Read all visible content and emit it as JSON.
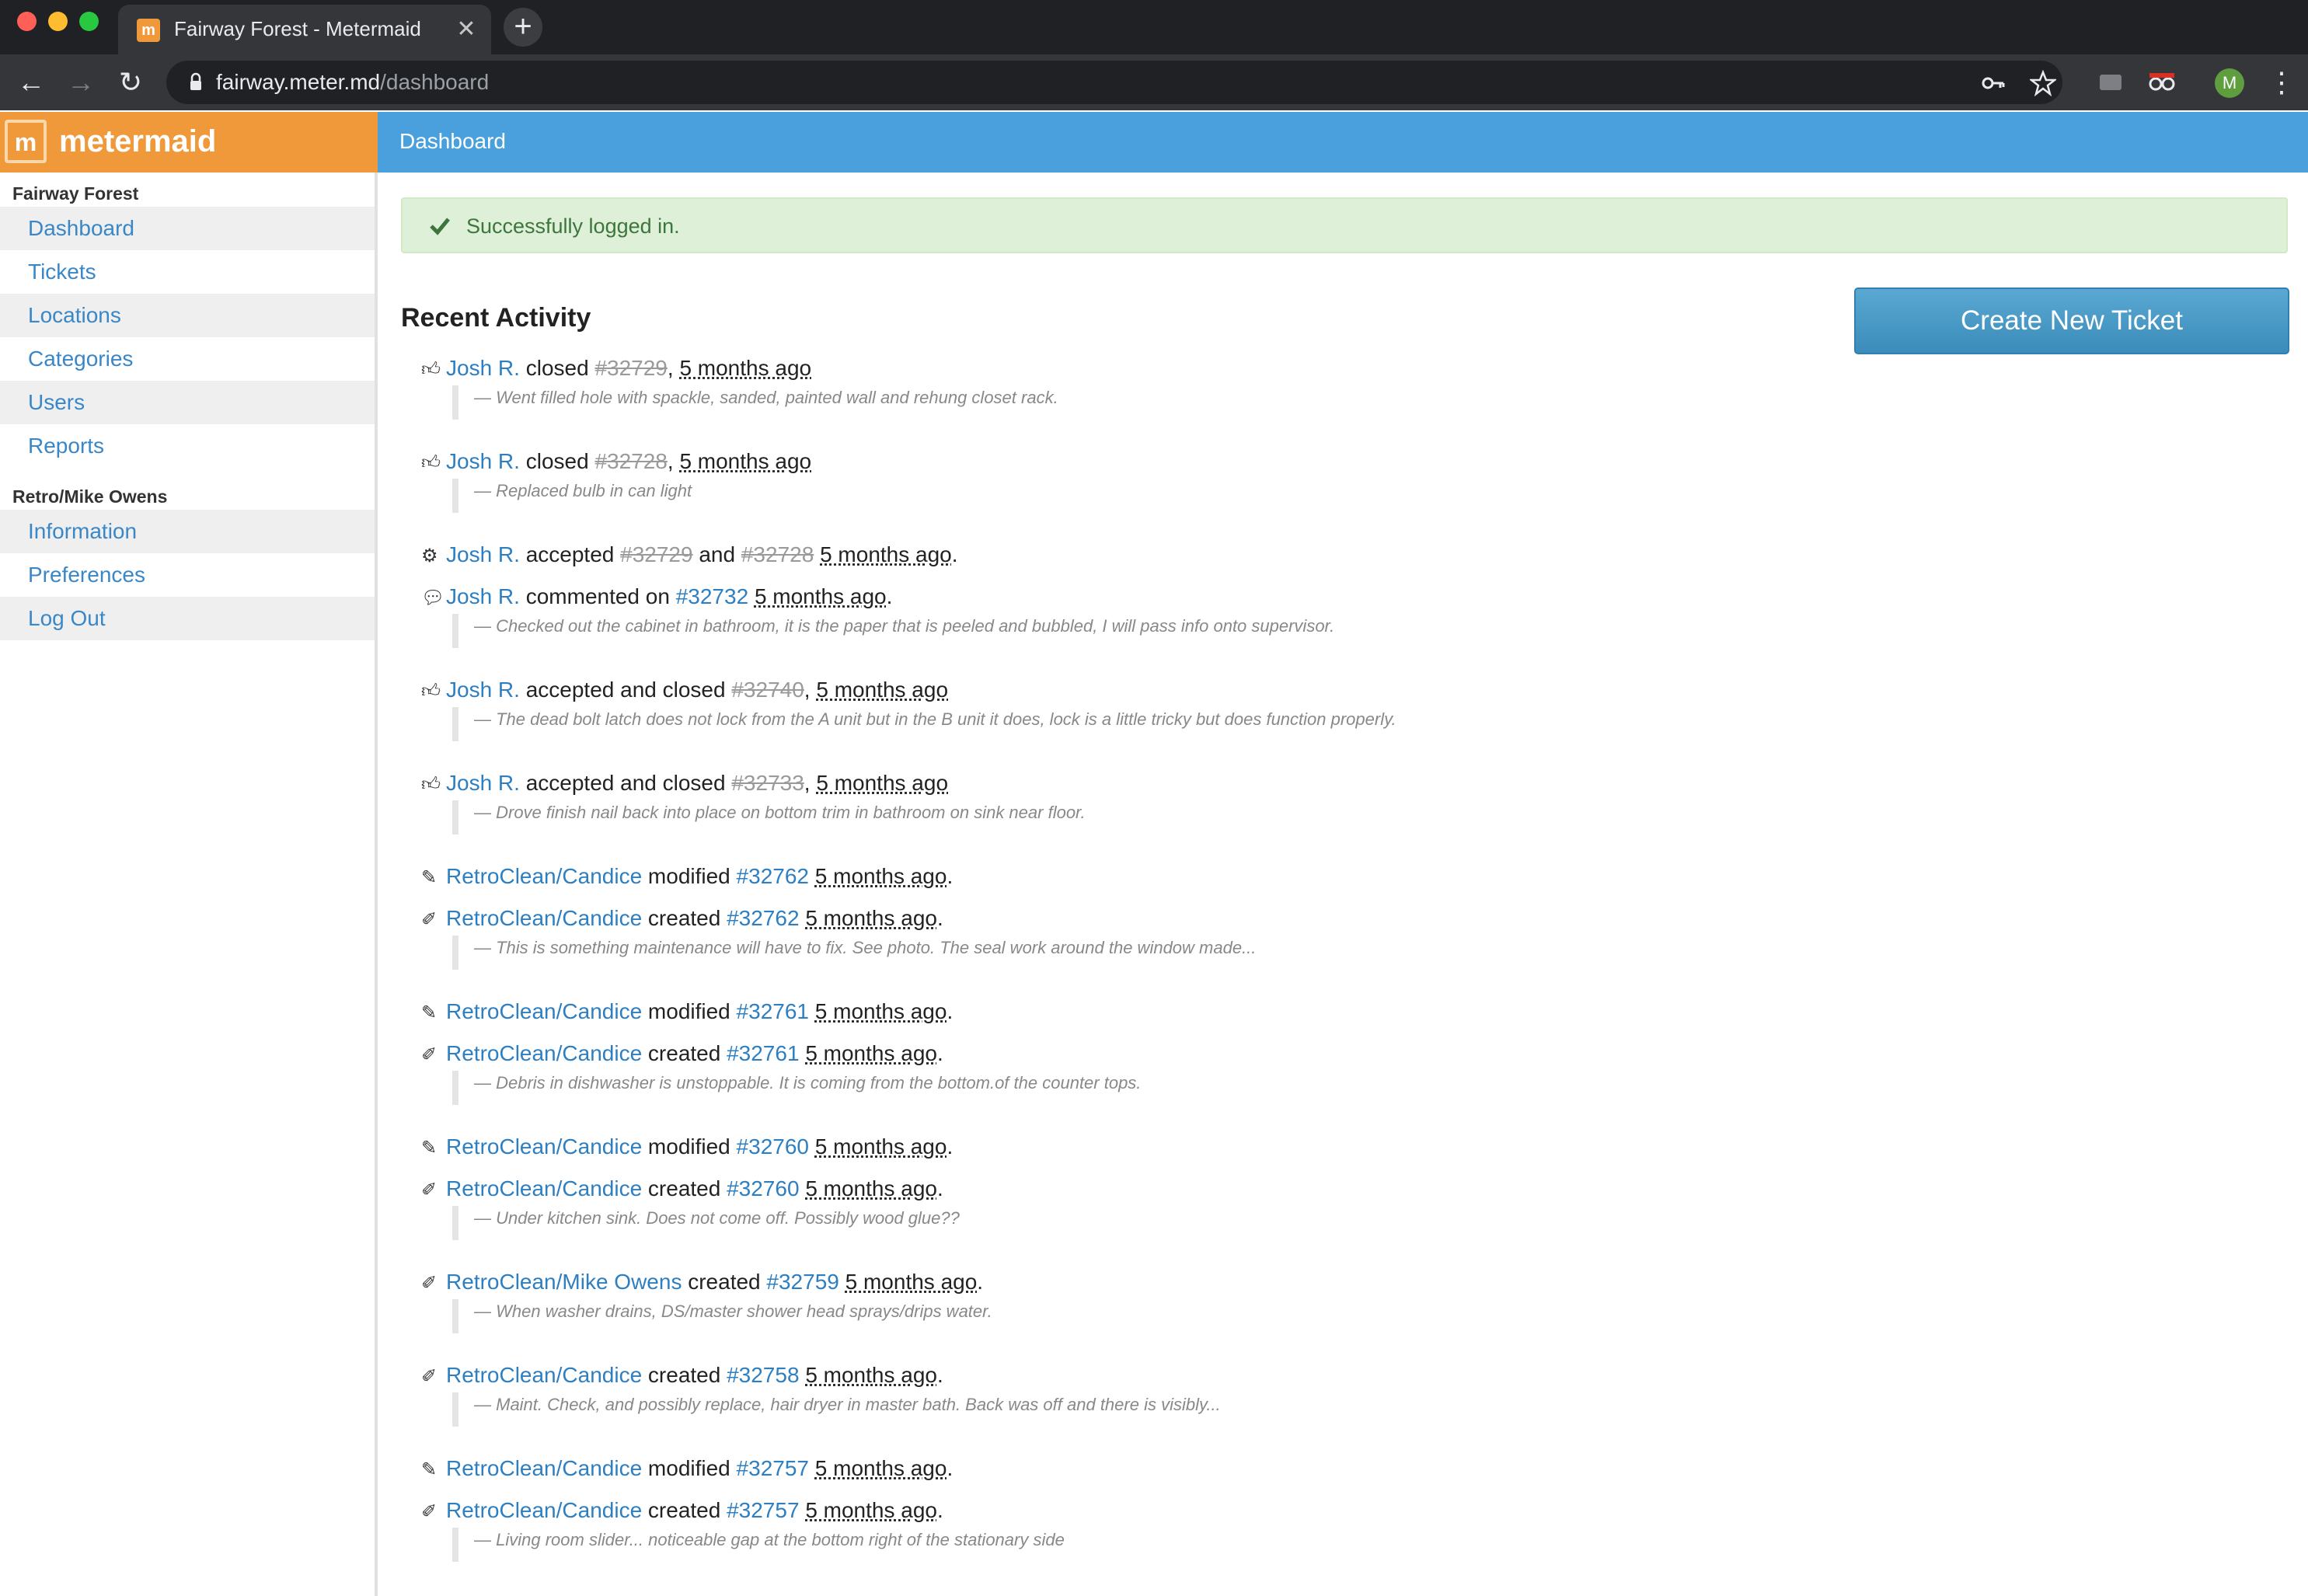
{
  "browser": {
    "tab_title": "Fairway Forest - Metermaid",
    "tab_favicon": "m",
    "tab_close": "✕",
    "new_tab": "+",
    "back": "←",
    "forward": "→",
    "reload": "↻",
    "url_host": "fairway.meter.md",
    "url_path": "/dashboard",
    "avatar_letter": "M",
    "menu": "⋮"
  },
  "app": {
    "logo_text": "metermaid",
    "logo_mark": "m",
    "page_title": "Dashboard"
  },
  "sidebar": {
    "section1": "Fairway Forest",
    "section1_items": [
      "Dashboard",
      "Tickets",
      "Locations",
      "Categories",
      "Users",
      "Reports"
    ],
    "section2": "Retro/Mike Owens",
    "section2_items": [
      "Information",
      "Preferences",
      "Log Out"
    ]
  },
  "alert": {
    "text": "Successfully logged in."
  },
  "recent_activity": {
    "title": "Recent Activity",
    "create_button": "Create New Ticket",
    "items": [
      {
        "icon": "thumbs-up-icon",
        "user": "Josh R.",
        "action": "closed",
        "tickets": [
          "#32729"
        ],
        "ago": "5 months ago",
        "comment": "— Went filled hole with spackle, sanded, painted wall and rehung closet rack."
      },
      {
        "icon": "thumbs-up-icon",
        "user": "Josh R.",
        "action": "closed",
        "tickets": [
          "#32728"
        ],
        "ago": "5 months ago",
        "comment": "— Replaced bulb in can light"
      },
      {
        "icon": "gears-icon",
        "user": "Josh R.",
        "action": "accepted",
        "tickets": [
          "#32729",
          "#32728"
        ],
        "ago": "5 months ago",
        "comment": ""
      },
      {
        "icon": "comment-icon",
        "user": "Josh R.",
        "action": "commented on",
        "tickets": [
          "#32732"
        ],
        "ago": "5 months ago",
        "comment": "— Checked out the cabinet in bathroom, it is the paper that is peeled and bubbled, I will pass info onto supervisor."
      },
      {
        "icon": "thumbs-up-icon",
        "user": "Josh R.",
        "action": "accepted and closed",
        "tickets": [
          "#32740"
        ],
        "ago": "5 months ago",
        "comment": "— The dead bolt latch does not lock from the A unit but in the B unit it does, lock is a little tricky but does function properly."
      },
      {
        "icon": "thumbs-up-icon",
        "user": "Josh R.",
        "action": "accepted and closed",
        "tickets": [
          "#32733"
        ],
        "ago": "5 months ago",
        "comment": "— Drove finish nail back into place on bottom trim in bathroom on sink near floor."
      },
      {
        "icon": "edit-icon",
        "user": "RetroClean/Candice",
        "action": "modified",
        "tickets": [
          "#32762"
        ],
        "ago": "5 months ago",
        "comment": ""
      },
      {
        "icon": "ticket-icon",
        "user": "RetroClean/Candice",
        "action": "created",
        "tickets": [
          "#32762"
        ],
        "ago": "5 months ago",
        "comment": "— This is something maintenance will have to fix. See photo. The seal work around the window made..."
      },
      {
        "icon": "edit-icon",
        "user": "RetroClean/Candice",
        "action": "modified",
        "tickets": [
          "#32761"
        ],
        "ago": "5 months ago",
        "comment": ""
      },
      {
        "icon": "ticket-icon",
        "user": "RetroClean/Candice",
        "action": "created",
        "tickets": [
          "#32761"
        ],
        "ago": "5 months ago",
        "comment": "— Debris in dishwasher is unstoppable. It is coming from the bottom.of the counter tops."
      },
      {
        "icon": "edit-icon",
        "user": "RetroClean/Candice",
        "action": "modified",
        "tickets": [
          "#32760"
        ],
        "ago": "5 months ago",
        "comment": ""
      },
      {
        "icon": "ticket-icon",
        "user": "RetroClean/Candice",
        "action": "created",
        "tickets": [
          "#32760"
        ],
        "ago": "5 months ago",
        "comment": "— Under kitchen sink. Does not come off. Possibly wood glue??"
      },
      {
        "icon": "ticket-icon",
        "user": "RetroClean/Mike Owens",
        "action": "created",
        "tickets": [
          "#32759"
        ],
        "ago": "5 months ago",
        "comment": "— When washer drains, DS/master shower head sprays/drips water."
      },
      {
        "icon": "ticket-icon",
        "user": "RetroClean/Candice",
        "action": "created",
        "tickets": [
          "#32758"
        ],
        "ago": "5 months ago",
        "comment": "— Maint. Check, and possibly replace, hair dryer in master bath. Back was off and there is visibly..."
      },
      {
        "icon": "edit-icon",
        "user": "RetroClean/Candice",
        "action": "modified",
        "tickets": [
          "#32757"
        ],
        "ago": "5 months ago",
        "comment": ""
      },
      {
        "icon": "ticket-icon",
        "user": "RetroClean/Candice",
        "action": "created",
        "tickets": [
          "#32757"
        ],
        "ago": "5 months ago",
        "comment": "— Living room slider... noticeable gap at the bottom right of the stationary side"
      }
    ]
  },
  "colors": {
    "brand_orange": "#f0993b",
    "header_blue": "#4aa0dc",
    "link_blue": "#2d7fc1",
    "success_bg": "#dff0d8",
    "success_text": "#3c763d"
  }
}
